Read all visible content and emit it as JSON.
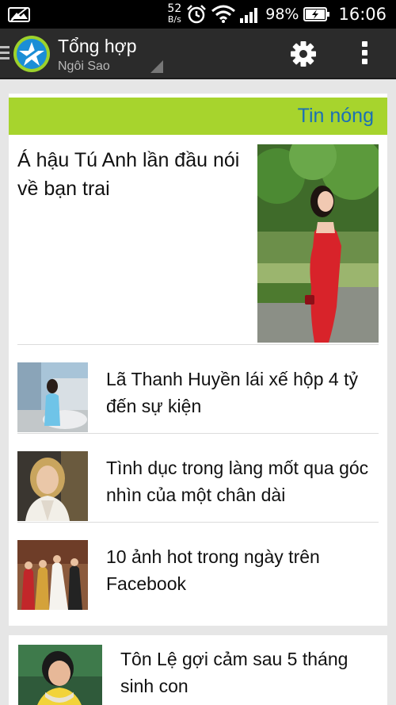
{
  "status_bar": {
    "network_speed_value": "52",
    "network_speed_unit": "B/s",
    "battery_percent": "98%",
    "time": "16:06"
  },
  "action_bar": {
    "title": "Tổng hợp",
    "subtitle": "Ngôi Sao"
  },
  "hot_news": {
    "header_label": "Tin nóng",
    "featured": {
      "title": "Á hậu Tú Anh lần đầu nói về bạn trai"
    },
    "items": [
      {
        "title": "Lã Thanh Huyền lái xế hộp 4 tỷ đến sự kiện"
      },
      {
        "title": "Tình dục trong làng mốt qua góc nhìn của một chân dài"
      },
      {
        "title": "10 ảnh hot trong ngày trên Facebook"
      }
    ]
  },
  "next_card": {
    "title": "Tôn Lệ gợi cảm sau 5 tháng sinh con"
  },
  "colors": {
    "status_bar_bg": "#000000",
    "action_bar_bg": "#2b2b2b",
    "header_green": "#a7d42d",
    "header_text_blue": "#1b6fb5",
    "page_bg": "#e6e6e6"
  }
}
